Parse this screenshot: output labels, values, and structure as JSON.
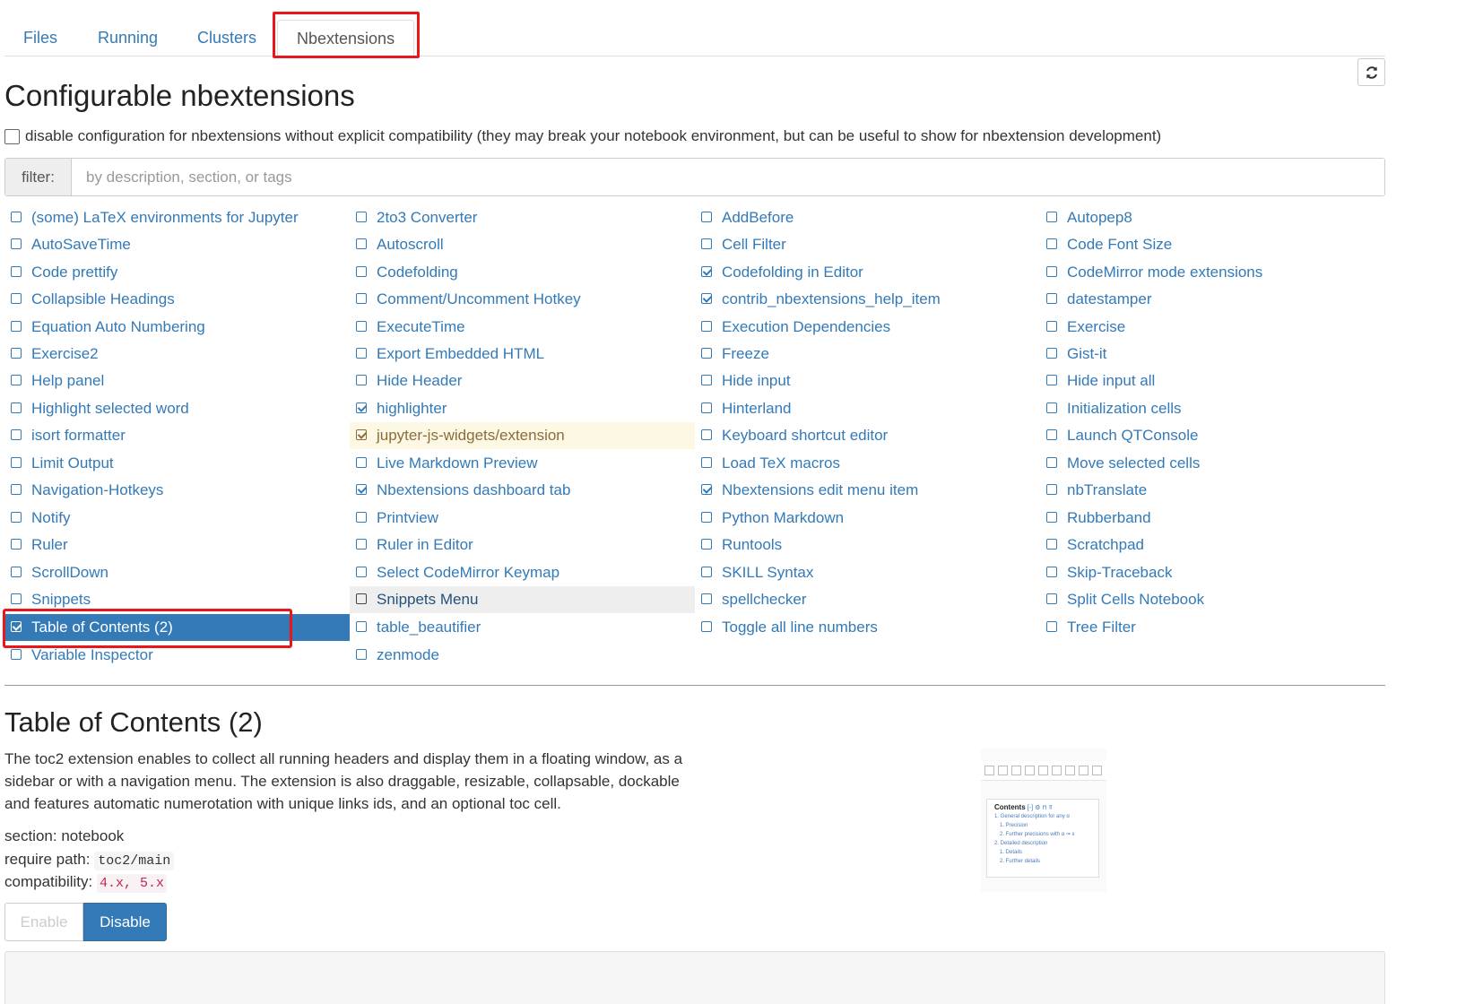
{
  "tabs": [
    {
      "label": "Files",
      "active": false
    },
    {
      "label": "Running",
      "active": false
    },
    {
      "label": "Clusters",
      "active": false
    },
    {
      "label": "Nbextensions",
      "active": true
    }
  ],
  "page_title": "Configurable nbextensions",
  "compat_checkbox_label": "disable configuration for nbextensions without explicit compatibility (they may break your notebook environment, but can be useful to show for nbextension development)",
  "filter": {
    "label": "filter:",
    "placeholder": "by description, section, or tags"
  },
  "extensions": [
    {
      "label": "(some) LaTeX environments for Jupyter",
      "checked": false
    },
    {
      "label": "2to3 Converter",
      "checked": false
    },
    {
      "label": "AddBefore",
      "checked": false
    },
    {
      "label": "Autopep8",
      "checked": false
    },
    {
      "label": "AutoSaveTime",
      "checked": false
    },
    {
      "label": "Autoscroll",
      "checked": false
    },
    {
      "label": "Cell Filter",
      "checked": false
    },
    {
      "label": "Code Font Size",
      "checked": false
    },
    {
      "label": "Code prettify",
      "checked": false
    },
    {
      "label": "Codefolding",
      "checked": false
    },
    {
      "label": "Codefolding in Editor",
      "checked": true
    },
    {
      "label": "CodeMirror mode extensions",
      "checked": false
    },
    {
      "label": "Collapsible Headings",
      "checked": false
    },
    {
      "label": "Comment/Uncomment Hotkey",
      "checked": false
    },
    {
      "label": "contrib_nbextensions_help_item",
      "checked": true
    },
    {
      "label": "datestamper",
      "checked": false
    },
    {
      "label": "Equation Auto Numbering",
      "checked": false
    },
    {
      "label": "ExecuteTime",
      "checked": false
    },
    {
      "label": "Execution Dependencies",
      "checked": false
    },
    {
      "label": "Exercise",
      "checked": false
    },
    {
      "label": "Exercise2",
      "checked": false
    },
    {
      "label": "Export Embedded HTML",
      "checked": false
    },
    {
      "label": "Freeze",
      "checked": false
    },
    {
      "label": "Gist-it",
      "checked": false
    },
    {
      "label": "Help panel",
      "checked": false
    },
    {
      "label": "Hide Header",
      "checked": false
    },
    {
      "label": "Hide input",
      "checked": false
    },
    {
      "label": "Hide input all",
      "checked": false
    },
    {
      "label": "Highlight selected word",
      "checked": false
    },
    {
      "label": "highlighter",
      "checked": true
    },
    {
      "label": "Hinterland",
      "checked": false
    },
    {
      "label": "Initialization cells",
      "checked": false
    },
    {
      "label": "isort formatter",
      "checked": false
    },
    {
      "label": "jupyter-js-widgets/extension",
      "checked": true,
      "state": "warn"
    },
    {
      "label": "Keyboard shortcut editor",
      "checked": false
    },
    {
      "label": "Launch QTConsole",
      "checked": false
    },
    {
      "label": "Limit Output",
      "checked": false
    },
    {
      "label": "Live Markdown Preview",
      "checked": false
    },
    {
      "label": "Load TeX macros",
      "checked": false
    },
    {
      "label": "Move selected cells",
      "checked": false
    },
    {
      "label": "Navigation-Hotkeys",
      "checked": false
    },
    {
      "label": "Nbextensions dashboard tab",
      "checked": true
    },
    {
      "label": "Nbextensions edit menu item",
      "checked": true
    },
    {
      "label": "nbTranslate",
      "checked": false
    },
    {
      "label": "Notify",
      "checked": false
    },
    {
      "label": "Printview",
      "checked": false
    },
    {
      "label": "Python Markdown",
      "checked": false
    },
    {
      "label": "Rubberband",
      "checked": false
    },
    {
      "label": "Ruler",
      "checked": false
    },
    {
      "label": "Ruler in Editor",
      "checked": false
    },
    {
      "label": "Runtools",
      "checked": false
    },
    {
      "label": "Scratchpad",
      "checked": false
    },
    {
      "label": "ScrollDown",
      "checked": false
    },
    {
      "label": "Select CodeMirror Keymap",
      "checked": false
    },
    {
      "label": "SKILL Syntax",
      "checked": false
    },
    {
      "label": "Skip-Traceback",
      "checked": false
    },
    {
      "label": "Snippets",
      "checked": false
    },
    {
      "label": "Snippets Menu",
      "checked": false,
      "state": "hover"
    },
    {
      "label": "spellchecker",
      "checked": false
    },
    {
      "label": "Split Cells Notebook",
      "checked": false
    },
    {
      "label": "Table of Contents (2)",
      "checked": true,
      "state": "selected"
    },
    {
      "label": "table_beautifier",
      "checked": false
    },
    {
      "label": "Toggle all line numbers",
      "checked": false
    },
    {
      "label": "Tree Filter",
      "checked": false
    },
    {
      "label": "Variable Inspector",
      "checked": false
    },
    {
      "label": "zenmode",
      "checked": false
    }
  ],
  "detail": {
    "title": "Table of Contents (2)",
    "description": "The toc2 extension enables to collect all running headers and display them in a floating window, as a sidebar or with a navigation menu. The extension is also draggable, resizable, collapsable, dockable and features automatic numerotation with unique links ids, and an optional toc cell.",
    "section_label": "section:",
    "section_value": "notebook",
    "require_label": "require path:",
    "require_value": "toc2/main",
    "compat_label": "compatibility:",
    "compat_value": "4.x, 5.x",
    "enable_label": "Enable",
    "disable_label": "Disable",
    "preview": {
      "heading": "Contents",
      "heading_controls": "[-] ⚙ ⊓ ⫪",
      "lines": [
        "1.  General description for any α",
        "1.  Precision",
        "2.  Further precisions with α ⇒ x",
        "2.  Detailed description",
        "1.  Details",
        "2.  Further details"
      ]
    }
  },
  "colors": {
    "link": "#337ab7",
    "selected_bg": "#337ab7",
    "warn_bg": "#fcf8e3",
    "highlight_red": "#e8171b"
  }
}
